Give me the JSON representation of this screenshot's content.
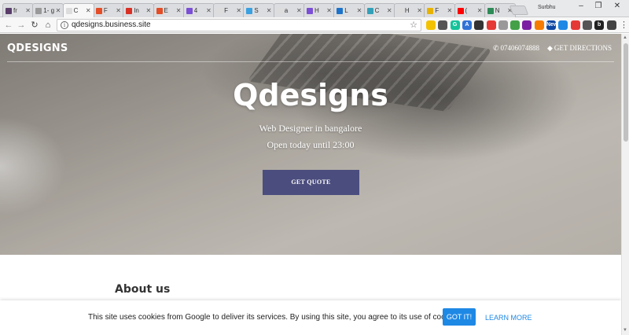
{
  "browser": {
    "tabs": [
      {
        "label": "fr",
        "color": "#5a3d6b"
      },
      {
        "label": "1- g",
        "color": "#999999"
      },
      {
        "label": "C",
        "color": "#dddddd",
        "active": true
      },
      {
        "label": "F",
        "color": "#e44d26"
      },
      {
        "label": "In",
        "color": "#d93025"
      },
      {
        "label": "E",
        "color": "#e44d26"
      },
      {
        "label": "4",
        "color": "#7b4fd6"
      },
      {
        "label": "F",
        "color": "#dddddd"
      },
      {
        "label": "S",
        "color": "#3aa0e0"
      },
      {
        "label": "a",
        "color": "#dddddd"
      },
      {
        "label": "H",
        "color": "#7b4fd6"
      },
      {
        "label": "L",
        "color": "#1d73c9"
      },
      {
        "label": "C",
        "color": "#34a0b8"
      },
      {
        "label": "H",
        "color": "#dddddd"
      },
      {
        "label": "F",
        "color": "#e8b300"
      },
      {
        "label": "(",
        "color": "#ff0000"
      },
      {
        "label": "N",
        "color": "#2e8b57"
      }
    ],
    "profile_name": "Surbhu",
    "url": "qdesigns.business.site"
  },
  "site": {
    "brand": "QDESIGNS",
    "phone": "07406074888",
    "directions": "GET DIRECTIONS",
    "title": "Qdesigns",
    "subtitle": "Web Designer in bangalore",
    "hours": "Open today until 23:00",
    "cta": "GET QUOTE",
    "about_heading": "About us"
  },
  "cookie": {
    "text": "This site uses cookies from Google to deliver its services. By using this site, you agree to its use of cookies.",
    "accept": "GOT IT!",
    "learn_more": "LEARN MORE"
  },
  "extensions": [
    {
      "name": "ext-1",
      "color": "#f2c200",
      "label": ""
    },
    {
      "name": "ext-2",
      "color": "#555555",
      "label": ""
    },
    {
      "name": "ext-3",
      "color": "#15c39a",
      "label": "G"
    },
    {
      "name": "ext-4",
      "color": "#2f73d6",
      "label": "A"
    },
    {
      "name": "ext-5",
      "color": "#333333",
      "label": ""
    },
    {
      "name": "ext-6",
      "color": "#e53935",
      "label": ""
    },
    {
      "name": "ext-7",
      "color": "#999999",
      "label": ""
    },
    {
      "name": "ext-8",
      "color": "#43a047",
      "label": ""
    },
    {
      "name": "ext-9",
      "color": "#7b1fa2",
      "label": ""
    },
    {
      "name": "ext-10",
      "color": "#f57c00",
      "label": ""
    },
    {
      "name": "ext-11",
      "color": "#0d47a1",
      "label": "New"
    },
    {
      "name": "ext-12",
      "color": "#1e88e5",
      "label": ""
    },
    {
      "name": "ext-13",
      "color": "#e53935",
      "label": ""
    },
    {
      "name": "ext-14",
      "color": "#555555",
      "label": ""
    },
    {
      "name": "ext-15",
      "color": "#222222",
      "label": "b"
    },
    {
      "name": "ext-16",
      "color": "#444444",
      "label": ""
    }
  ]
}
